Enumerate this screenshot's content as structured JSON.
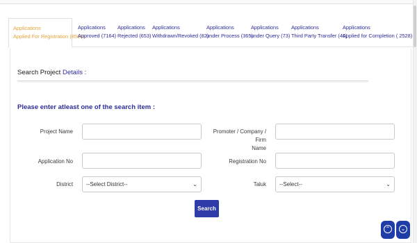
{
  "tabs": [
    {
      "line1": "Applications",
      "line2": "Applied For Registration (8564)",
      "active": true
    },
    {
      "line1": "Applications",
      "line2": "Approved (7164)"
    },
    {
      "line1": "Applications",
      "line2": "Rejected (653)"
    },
    {
      "line1": "Applications",
      "line2": "Withdrawn/Revoked (82)"
    },
    {
      "line1": "Applications",
      "line2": "under Process (365)"
    },
    {
      "line1": "Applications",
      "line2": "under Query (73)"
    },
    {
      "line1": "Applications",
      "line2": "Third Party Transfer (40)"
    },
    {
      "line1": "Applications",
      "line2": "Applied for Completion ( 2528)"
    }
  ],
  "search": {
    "title_plain": "Search Project ",
    "title_accent": "Details :",
    "instruction": "Please enter atleast one of the search item :",
    "fields": {
      "project_name_label": "Project Name",
      "promoter_label_1": "Promoter / Company / Firm",
      "promoter_label_2": "Name",
      "application_no_label": "Application No",
      "registration_no_label": "Registration No",
      "district_label": "District",
      "district_value": "--Select District--",
      "taluk_label": "Taluk",
      "taluk_value": "--Select--"
    },
    "button": "Search"
  },
  "colors": {
    "active_tab": "#e6a23c",
    "link": "#2c2c9a",
    "button": "#2e3ba8"
  },
  "icons": {
    "scroll_up": "chevron-up-circle-icon",
    "scroll_down": "chevron-down-circle-icon"
  }
}
